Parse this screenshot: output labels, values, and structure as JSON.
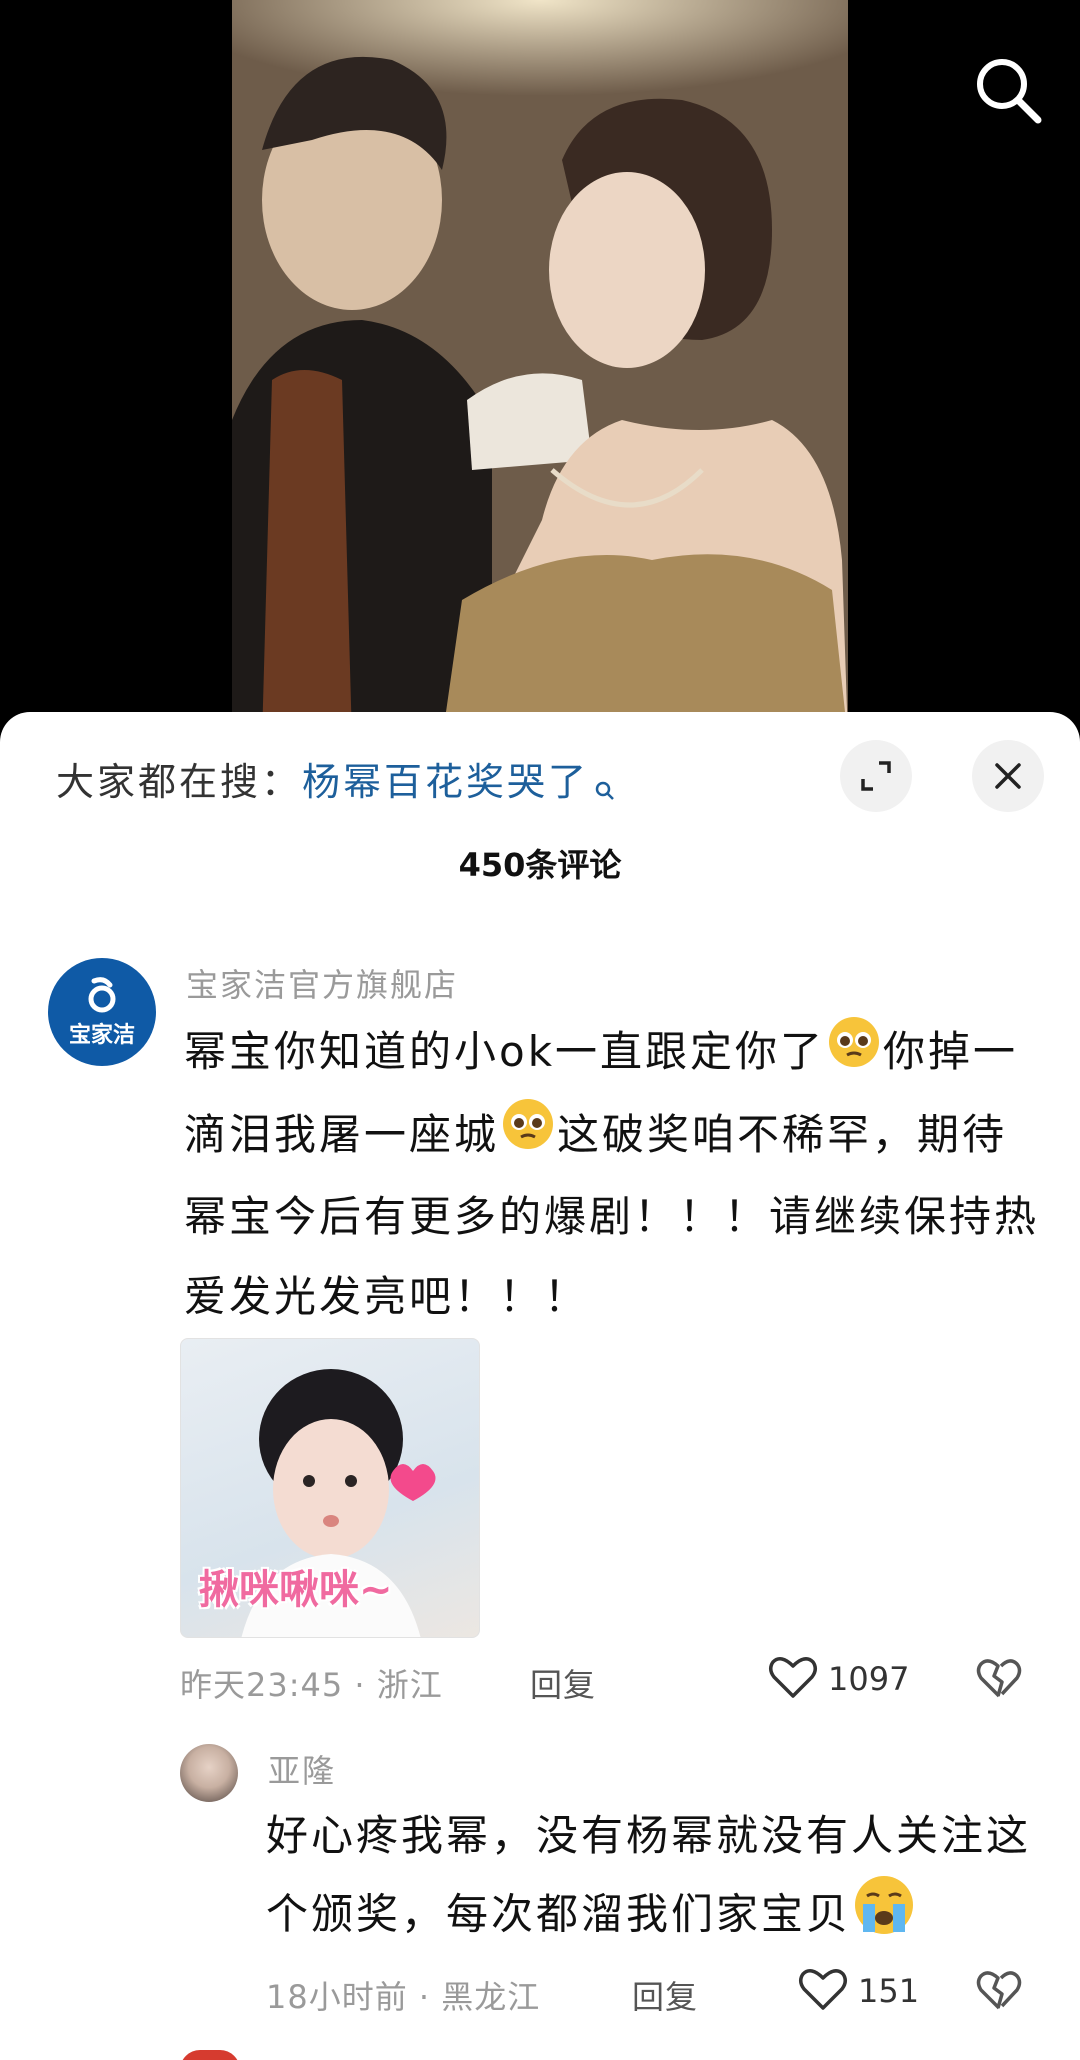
{
  "search_suggest": {
    "prefix": "大家都在搜：",
    "term": "杨幂百花奖哭了"
  },
  "comment_count": "450条评论",
  "comments": [
    {
      "author": "宝家洁官方旗舰店",
      "avatar_text": "宝家洁",
      "text_segments": [
        "幂宝你知道的小ok一直跟定你了",
        "你掉一滴泪我屠一座城",
        "这破奖咱不稀罕，期待幂宝今后有更多的爆剧！！！请继续保持热爱发光发亮吧！！！"
      ],
      "sticker_caption": "揪咪啾咪~",
      "time_location": "昨天23:45 · 浙江",
      "reply": "回复",
      "likes": "1097"
    },
    {
      "author": "亚隆",
      "text": "好心疼我幂，没有杨幂就没有人关注这个颁奖，每次都溜我们家宝贝",
      "time_location": "18小时前 · 黑龙江",
      "reply": "回复",
      "likes": "151"
    }
  ],
  "icons": {
    "search": "search-icon",
    "expand": "expand-icon",
    "close": "close-icon",
    "like": "heart-outline-icon",
    "dislike": "broken-heart-icon",
    "emoji_pleading": "pleading-face-emoji",
    "emoji_crying": "crying-face-emoji"
  },
  "colors": {
    "search_term": "#1d5f9b",
    "brand_avatar": "#0f5aa6",
    "muted_text": "#9a9a9a"
  }
}
